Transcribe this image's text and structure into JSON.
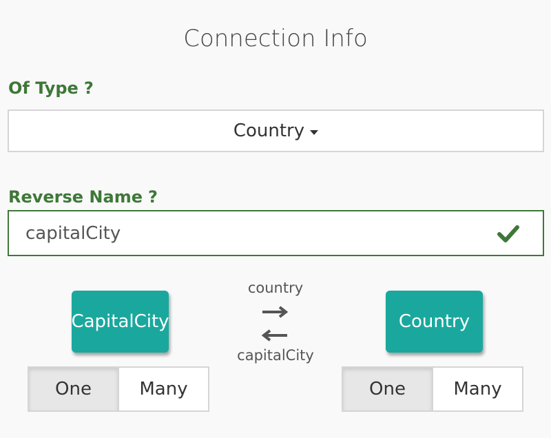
{
  "dialog": {
    "title": "Connection Info"
  },
  "of_type": {
    "label": "Of Type",
    "help": "?",
    "selected": "Country"
  },
  "reverse_name": {
    "label": "Reverse Name",
    "help": "?",
    "value": "capitalCity",
    "valid_icon": "check-icon",
    "valid_color": "#3e7838"
  },
  "relation": {
    "forward_label": "country",
    "reverse_label": "capitalCity",
    "source": {
      "name": "CapitalCity",
      "cardinality_options": [
        "One",
        "Many"
      ],
      "selected": "One"
    },
    "target": {
      "name": "Country",
      "cardinality_options": [
        "One",
        "Many"
      ],
      "selected": "One"
    }
  },
  "colors": {
    "accent_green": "#3e7838",
    "entity_teal": "#1aa89e"
  }
}
